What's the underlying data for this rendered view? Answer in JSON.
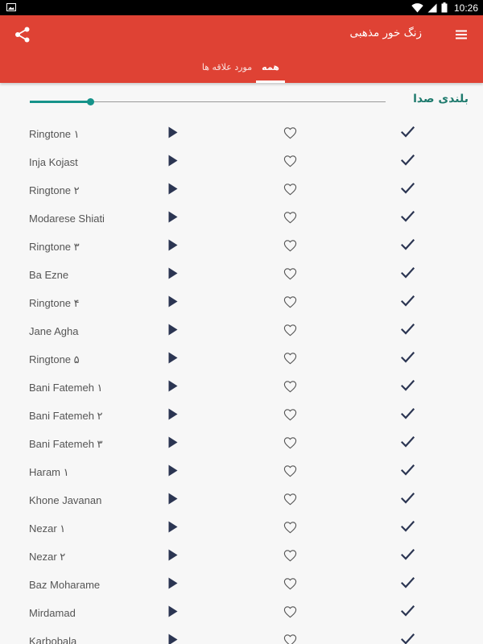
{
  "status_bar": {
    "time": "10:26",
    "icons": [
      "image-icon",
      "wifi-icon",
      "signal-icon",
      "battery-icon"
    ]
  },
  "app_bar": {
    "title": "زنگ خور مذهبی",
    "tabs": [
      {
        "label": "همه",
        "selected": true
      },
      {
        "label": "مورد علاقه ها",
        "selected": false
      }
    ]
  },
  "volume": {
    "label": "بلندی صدا",
    "level": 0.17
  },
  "colors": {
    "app_bar": "#df4234",
    "accent": "#16938a",
    "icon": "#2b3552"
  },
  "ringtones": [
    "Ringtone ۱",
    "Inja Kojast",
    "Ringtone ۲",
    "Modarese Shiati",
    "Ringtone ۳",
    "Ba Ezne",
    "Ringtone ۴",
    "Jane Agha",
    "Ringtone ۵",
    "Bani Fatemeh ۱",
    "Bani Fatemeh ۲",
    "Bani Fatemeh ۳",
    "Haram ۱",
    "Khone Javanan",
    "Nezar ۱",
    "Nezar ۲",
    "Baz Moharame",
    "Mirdamad",
    "Karbobala"
  ]
}
